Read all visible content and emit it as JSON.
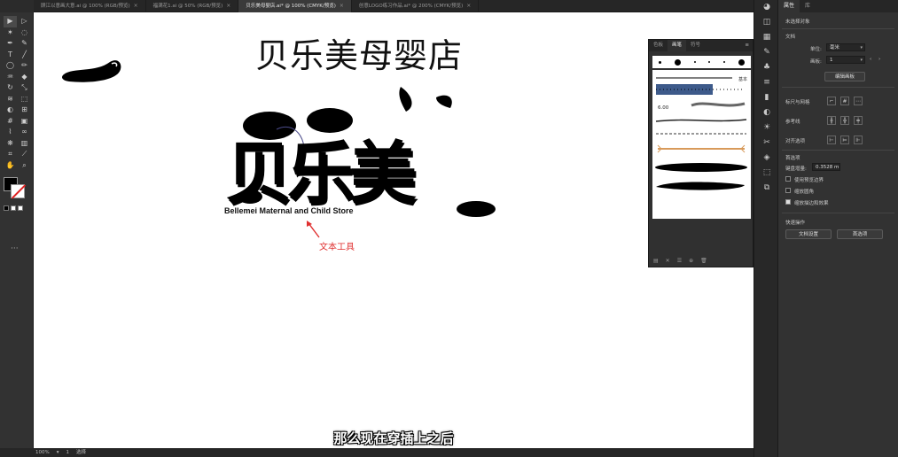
{
  "tabs": [
    {
      "label": "顾江以意画大意.ai @ 100% (RGB/预览)",
      "active": false
    },
    {
      "label": "福满花1.ai @ 50% (RGB/预览)",
      "active": false
    },
    {
      "label": "贝乐美母婴店.ai* @ 100% (CMYK/预览)",
      "active": true
    },
    {
      "label": "创意LOGO练习作品.ai* @ 200% (CMYK/预览)",
      "active": false
    }
  ],
  "tab_close": "×",
  "canvas": {
    "store_title": "贝乐美母婴店",
    "logo_text": "贝乐美",
    "tagline": "Bellemei Maternal and Child Store",
    "annotation": "文本工具",
    "subtitle": "那么现在穿插上之后"
  },
  "brushes_panel": {
    "tabs": [
      "色板",
      "画笔",
      "符号"
    ],
    "menu": "≡",
    "basic_label": "基本",
    "brush_size": "6.00",
    "footer_icons": [
      "brush-library-icon",
      "remove-stroke-icon",
      "options-icon",
      "new-brush-icon",
      "delete-icon"
    ]
  },
  "properties": {
    "tabs": [
      "属性",
      "库"
    ],
    "no_selection": "未选择对象",
    "document_heading": "文档",
    "unit_label": "单位:",
    "unit_value": "毫米",
    "artboard_label": "画板:",
    "artboard_value": "1",
    "edit_artboard": "编辑画板",
    "rulers_grids": "标尺与网格",
    "guides": "参考线",
    "snap": "对齐选项",
    "preferences_heading": "首选项",
    "keyboard_increment_label": "键盘增量:",
    "keyboard_increment_value": "0.3528 m",
    "use_preview_bounds": "使用预览边界",
    "scale_corners": "缩放圆角",
    "scale_strokes": "缩放描边和效果",
    "quick_actions_heading": "快速操作",
    "document_setup": "文档设置",
    "preferences_button": "首选项"
  },
  "statusbar": {
    "zoom": "100%",
    "page": "1",
    "tool": "选择"
  },
  "colors": {
    "accent_red": "#e03030",
    "canvas_bg": "#ffffff",
    "panel_bg": "#323232"
  }
}
